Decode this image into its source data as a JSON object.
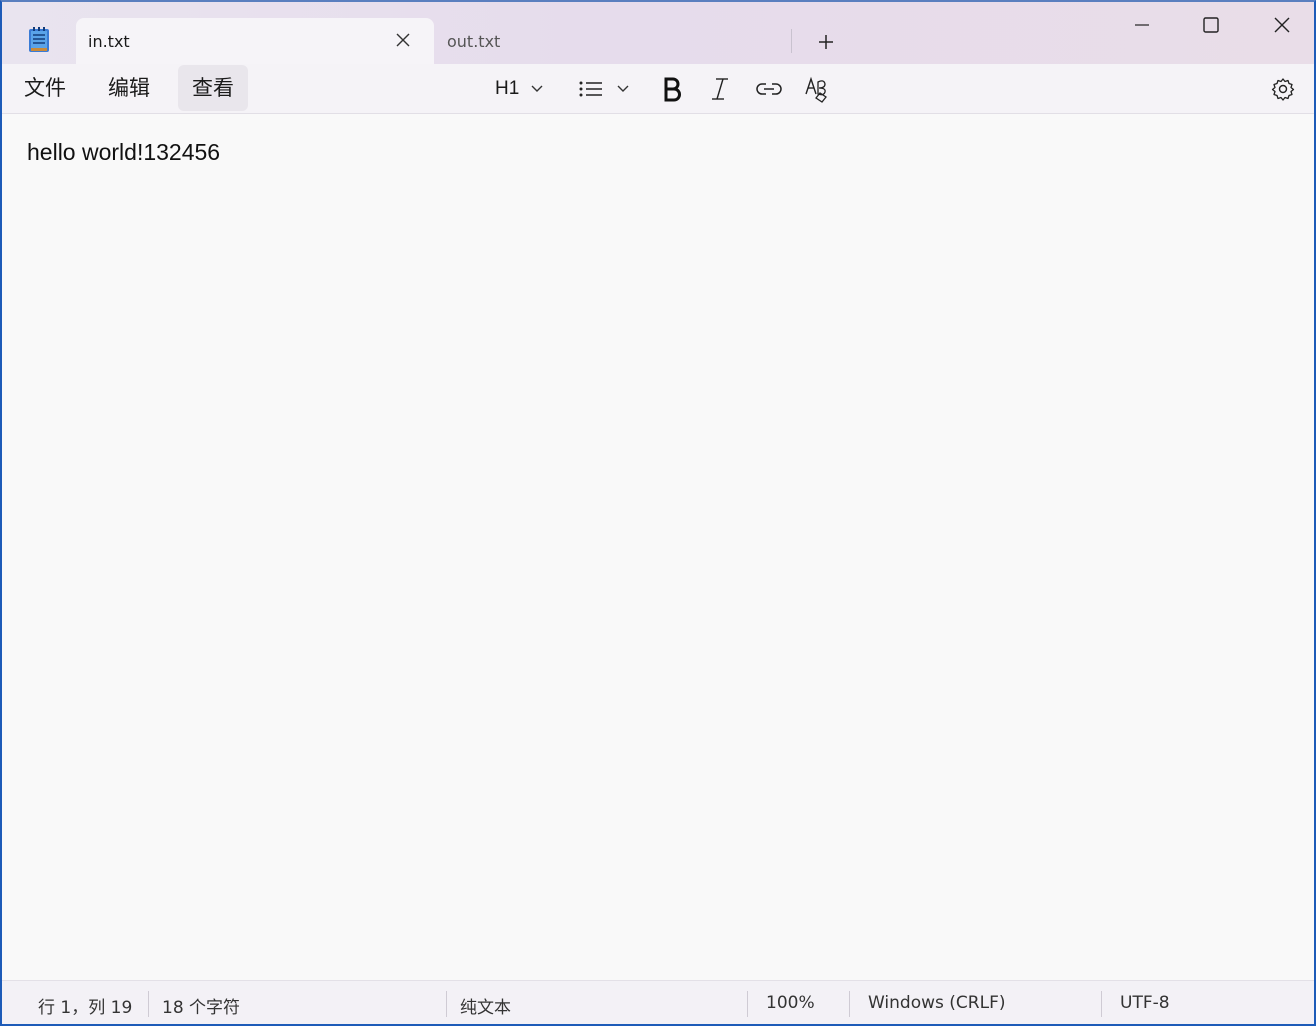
{
  "tabs": [
    {
      "label": "in.txt",
      "active": true
    },
    {
      "label": "out.txt",
      "active": false
    }
  ],
  "window_controls": {
    "minimize": "minimize-icon",
    "maximize": "maximize-icon",
    "close": "close-icon"
  },
  "menu": {
    "file": "文件",
    "edit": "编辑",
    "view": "查看"
  },
  "toolbar": {
    "heading_label": "H1",
    "icons": [
      "heading-dropdown",
      "list-icon",
      "bold-icon",
      "italic-icon",
      "link-icon",
      "spellcheck-icon",
      "gear-icon"
    ]
  },
  "editor": {
    "content": "hello world!132456"
  },
  "status": {
    "position": "行 1，列 19",
    "char_count": "18 个字符",
    "format": "纯文本",
    "zoom": "100%",
    "line_ending": "Windows (CRLF)",
    "encoding": "UTF-8"
  },
  "colors": {
    "accent_border": "#1d5bb8",
    "titlebar": "#e6dcec",
    "editor_bg": "#f9f9f9"
  }
}
